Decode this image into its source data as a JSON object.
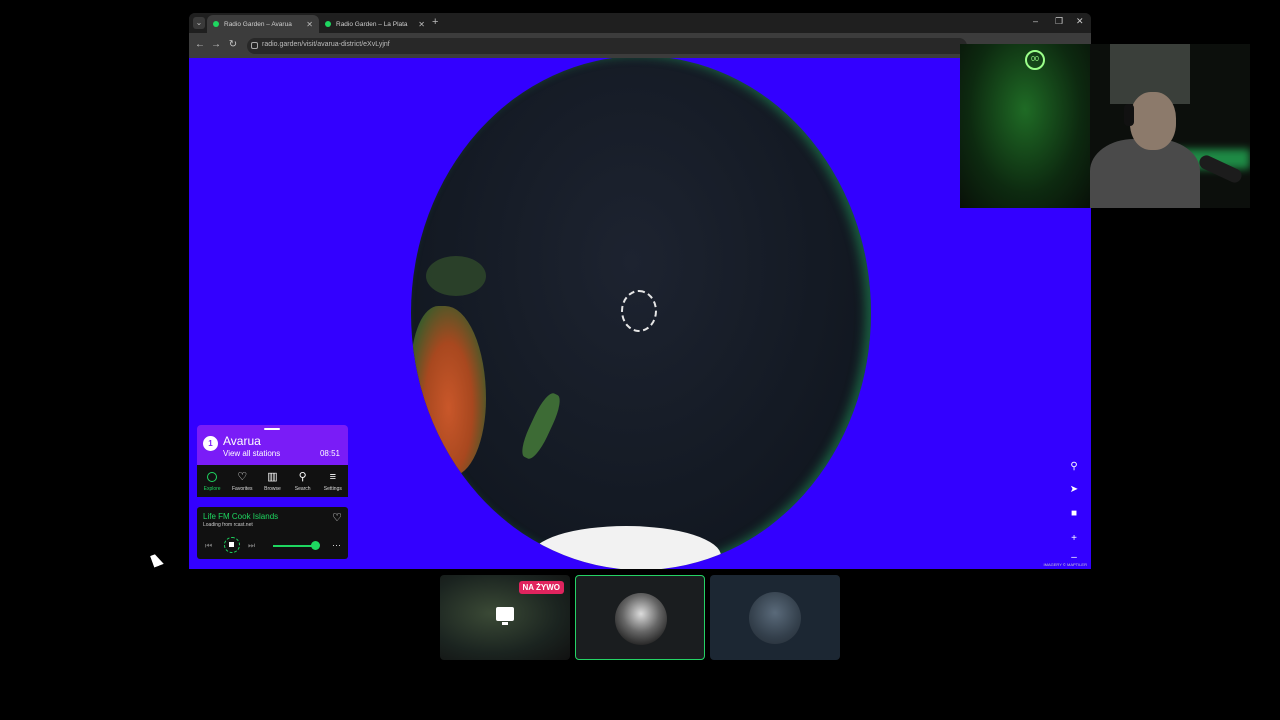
{
  "browser": {
    "tabs": [
      {
        "title": "Radio Garden – Avarua",
        "active": true
      },
      {
        "title": "Radio Garden – La Plata",
        "active": false
      }
    ],
    "url": "radio.garden/visit/avarua-district/eXvLyjnf",
    "new_tab_icon": "plus-icon"
  },
  "radio": {
    "place_index": "1",
    "place_name": "Avarua",
    "view_all": "View all stations",
    "local_time": "08:51",
    "nav": [
      {
        "label": "Explore",
        "icon": "explore-icon",
        "active": true
      },
      {
        "label": "Favorites",
        "icon": "heart-icon",
        "active": false
      },
      {
        "label": "Browse",
        "icon": "map-icon",
        "active": false
      },
      {
        "label": "Search",
        "icon": "search-icon",
        "active": false
      },
      {
        "label": "Settings",
        "icon": "menu-icon",
        "active": false
      }
    ],
    "player": {
      "station": "Life FM Cook Islands",
      "status": "Loading from rcast.net",
      "volume_fraction": 0.9
    },
    "attribution": "IMAGERY © MAPTILER"
  },
  "thumbnails": {
    "live_label": "NA ŻYWO"
  },
  "colors": {
    "background": "#3300ff",
    "accent": "#1ed760",
    "panel": "#7a1cf7",
    "live": "#e0245e"
  }
}
